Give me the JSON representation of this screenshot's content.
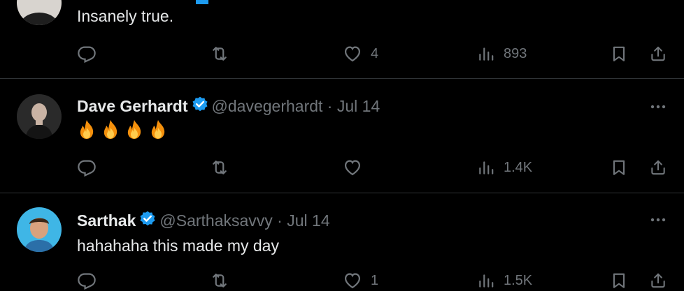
{
  "colors": {
    "background": "#000000",
    "text": "#e7e9ea",
    "muted": "#71767b",
    "divider": "#2f3336",
    "verified": "#1d9bf0"
  },
  "tweets": [
    {
      "text": "Insanely true.",
      "actions": {
        "reply": "",
        "retweet": "",
        "like": "4",
        "views": "893"
      }
    },
    {
      "name": "Dave Gerhardt",
      "handle": "@davegerhardt",
      "separator": "·",
      "date": "Jul 14",
      "emoji_count": 4,
      "emoji": "fire-emoji",
      "actions": {
        "reply": "",
        "retweet": "",
        "like": "",
        "views": "1.4K"
      }
    },
    {
      "name": "Sarthak",
      "handle": "@Sarthaksavvy",
      "separator": "·",
      "date": "Jul 14",
      "text": "hahahaha this made my day",
      "actions": {
        "reply": "",
        "retweet": "",
        "like": "1",
        "views": "1.5K"
      }
    }
  ]
}
